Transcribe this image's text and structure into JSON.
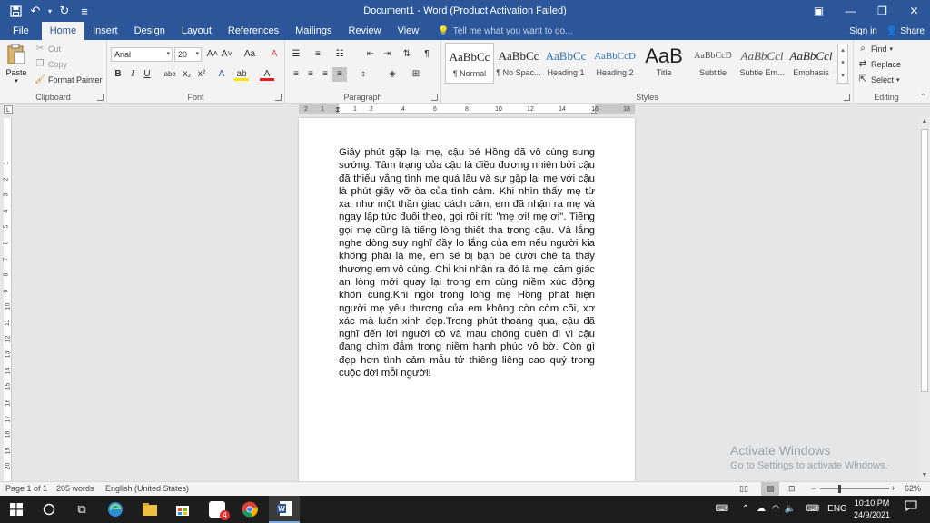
{
  "window": {
    "title": "Document1 - Word (Product Activation Failed)",
    "qat_save": "💾",
    "qat_undo": "↶",
    "qat_redo": "↻",
    "qat_customize": "≡",
    "ctl_ribbon_opts": "▣",
    "ctl_minimize": "—",
    "ctl_restore": "❐",
    "ctl_close": "✕"
  },
  "tabs": [
    "File",
    "Home",
    "Insert",
    "Design",
    "Layout",
    "References",
    "Mailings",
    "Review",
    "View"
  ],
  "active_tab": "Home",
  "tell_me": "Tell me what you want to do...",
  "sign_in": "Sign in",
  "share": "Share",
  "clipboard": {
    "paste": "Paste",
    "cut": "Cut",
    "copy": "Copy",
    "format_painter": "Format Painter",
    "label": "Clipboard"
  },
  "font": {
    "name": "Arial",
    "size": "20",
    "label": "Font",
    "bold": "B",
    "italic": "I",
    "underline": "U",
    "strike": "abc",
    "subscript": "x₂",
    "superscript": "x²",
    "grow": "A˄",
    "shrink": "A˅",
    "case": "Aa",
    "clear": "A",
    "effects": "A",
    "highlight": "ab",
    "color": "A"
  },
  "paragraph": {
    "label": "Paragraph"
  },
  "styles": {
    "label": "Styles",
    "items": [
      {
        "sample": "AaBbCc",
        "name": "¶ Normal"
      },
      {
        "sample": "AaBbCc",
        "name": "¶ No Spac..."
      },
      {
        "sample": "AaBbCc",
        "name": "Heading 1"
      },
      {
        "sample": "AaBbCcD",
        "name": "Heading 2"
      },
      {
        "sample": "AaB",
        "name": "Title"
      },
      {
        "sample": "AaBbCcD",
        "name": "Subtitle"
      },
      {
        "sample": "AaBbCcl",
        "name": "Subtle Em..."
      },
      {
        "sample": "AaBbCcl",
        "name": "Emphasis"
      }
    ]
  },
  "editing": {
    "find": "Find",
    "replace": "Replace",
    "select": "Select",
    "label": "Editing"
  },
  "ruler": {
    "h_numbers": [
      "2",
      "1",
      "1",
      "2",
      "4",
      "6",
      "8",
      "10",
      "12",
      "14",
      "16",
      "18"
    ],
    "v_numbers": [
      "1",
      "2",
      "3",
      "4",
      "5",
      "6",
      "7",
      "8",
      "9",
      "10",
      "11",
      "12",
      "13",
      "14",
      "15",
      "16",
      "17",
      "18",
      "19",
      "20"
    ]
  },
  "document": {
    "body": "Giây phút gặp lại mẹ, cậu bé Hồng đã vô cùng sung sướng. Tâm trạng của cậu là điều đương nhiên bởi cậu đã thiếu vắng tình mẹ quá lâu và sự gặp lại mẹ với cậu là phút giây vỡ òa của tình cảm. Khi nhìn thấy mẹ từ xa, như một thần giao cách cảm, em đã nhận ra mẹ và ngay lập tức đuổi theo, gọi rối rít: \"mẹ ơi! mẹ ơi\". Tiếng gọi mẹ cũng là tiếng lòng thiết tha trong cậu. Và lắng nghe dòng suy nghĩ đầy lo lắng của em nếu người kia không phải là mẹ, em sẽ bị bạn bè cười chê ta thấy thương em vô cùng. Chỉ khi nhận ra đó là mẹ, cảm giác an lòng mới quay lại trong em cùng niềm xúc động khôn cùng.Khi ngồi trong lòng mẹ Hồng phát hiện người mẹ yêu thương của em không còn còm cõi, xơ xác mà luôn xinh đẹp.Trong phút thoáng qua, cậu đã nghĩ đến lời người cô và mau chóng quên đi vì cậu đang chìm đắm trong niềm hạnh phúc vô bờ. Còn gì đẹp hơn tình cảm mẫu tử thiêng liêng cao quý trong cuộc đời mỗi người!"
  },
  "watermark": {
    "line1": "Activate Windows",
    "line2": "Go to Settings to activate Windows."
  },
  "status": {
    "page": "Page 1 of 1",
    "words": "205 words",
    "language": "English (United States)",
    "zoom": "62%"
  },
  "taskbar": {
    "mail_badge": "4",
    "lang": "ENG",
    "time": "10:10 PM",
    "date": "24/9/2021"
  }
}
